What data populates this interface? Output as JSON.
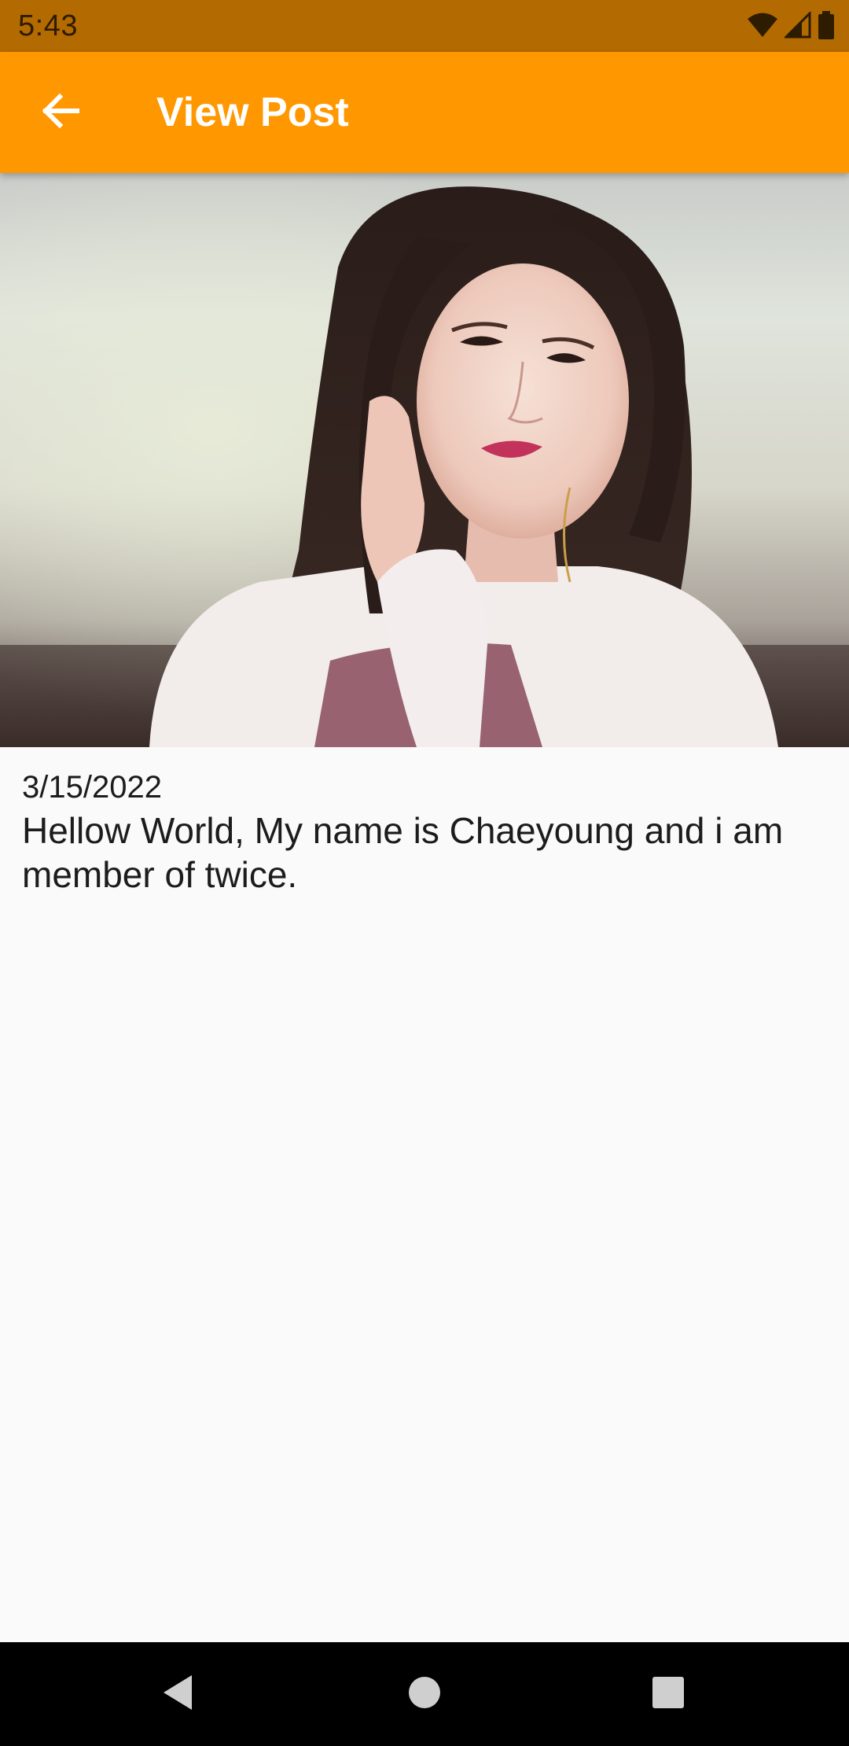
{
  "status_bar": {
    "time": "5:43",
    "icons": [
      "wifi-icon",
      "cellular-signal-icon",
      "battery-icon"
    ],
    "background": "#b36a00"
  },
  "app_bar": {
    "title": "View Post",
    "back_icon": "arrow-back-icon",
    "background": "#ff9800"
  },
  "post": {
    "image_description": "photo",
    "date": "3/15/2022",
    "text": "Hellow World, My name is Chaeyoung and i am member of twice."
  },
  "nav_bar": {
    "buttons": [
      "back-triangle-icon",
      "home-circle-icon",
      "recents-square-icon"
    ]
  }
}
